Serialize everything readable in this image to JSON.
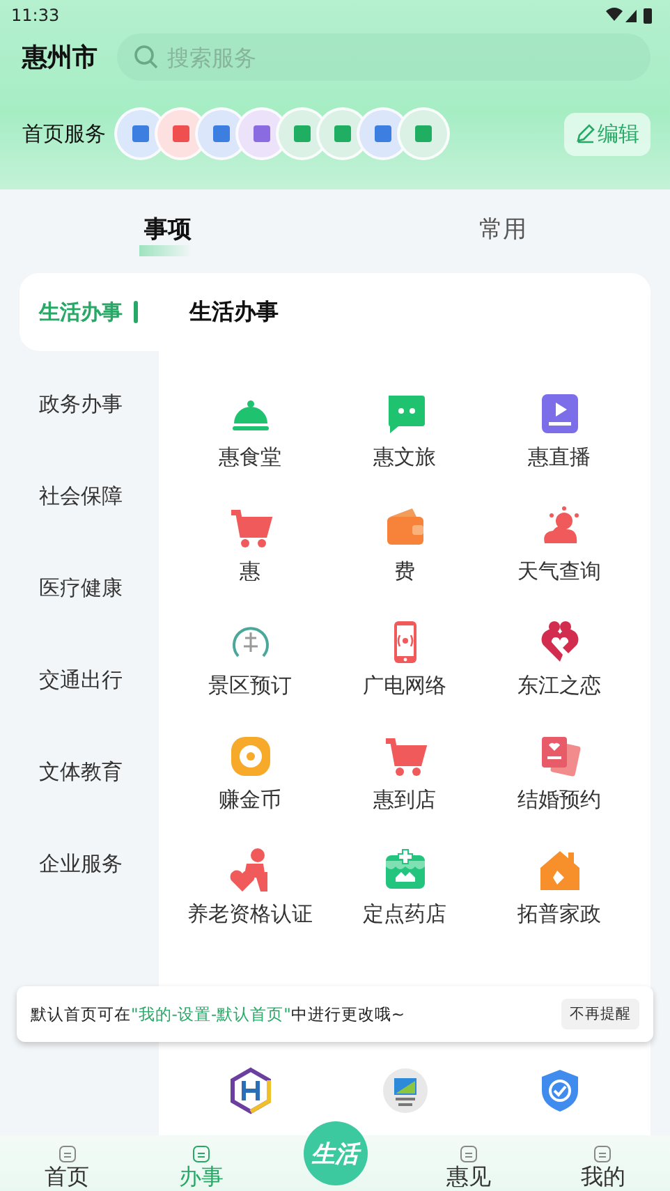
{
  "status_bar": {
    "time": "11:33"
  },
  "header": {
    "city": "惠州市",
    "search": {
      "placeholder": "搜索服务"
    },
    "home_services": {
      "label": "首页服务",
      "edit_button": "编辑"
    }
  },
  "tabs": [
    {
      "label": "事项",
      "selected": true
    },
    {
      "label": "常用",
      "selected": false
    }
  ],
  "sidebar": {
    "items": [
      {
        "label": "生活办事",
        "selected": true
      },
      {
        "label": "政务办事",
        "selected": false
      },
      {
        "label": "社会保障",
        "selected": false
      },
      {
        "label": "医疗健康",
        "selected": false
      },
      {
        "label": "交通出行",
        "selected": false
      },
      {
        "label": "文体教育",
        "selected": false
      },
      {
        "label": "企业服务",
        "selected": false
      }
    ]
  },
  "panel": {
    "title": "生活办事",
    "items": [
      {
        "label": "惠食堂"
      },
      {
        "label": "惠文旅"
      },
      {
        "label": "惠直播"
      },
      {
        "label": "惠"
      },
      {
        "label": "费"
      },
      {
        "label": "天气查询"
      },
      {
        "label": "景区预订"
      },
      {
        "label": "广电网络"
      },
      {
        "label": "东江之恋"
      },
      {
        "label": "赚金币"
      },
      {
        "label": "惠到店"
      },
      {
        "label": "结婚预约"
      },
      {
        "label": "养老资格认证"
      },
      {
        "label": "定点药店"
      },
      {
        "label": "拓普家政"
      }
    ]
  },
  "tip": {
    "before": "默认首页可在",
    "highlight": "\"我的-设置-默认首页\"",
    "after": "中进行更改哦~",
    "dismiss_button": "不再提醒"
  },
  "bottom_nav": [
    {
      "label": "首页",
      "selected": false
    },
    {
      "label": "办事",
      "selected": true
    },
    {
      "label": "生活",
      "kind": "center"
    },
    {
      "label": "惠见",
      "selected": false
    },
    {
      "label": "我的",
      "selected": false
    }
  ]
}
